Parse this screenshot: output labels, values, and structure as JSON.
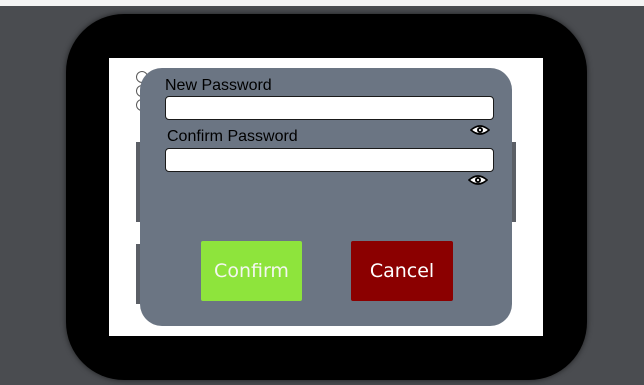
{
  "dialog": {
    "new_password": {
      "label": "New Password",
      "value": "",
      "placeholder": ""
    },
    "confirm_password": {
      "label": "Confirm Password",
      "value": "",
      "placeholder": ""
    },
    "visibility_icon": "eye-icon",
    "confirm_label": "Confirm",
    "cancel_label": "Cancel"
  },
  "colors": {
    "backdrop": "#4a4c50",
    "device_frame": "#000000",
    "screen": "#ffffff",
    "modal": "#6b7583",
    "confirm_button": "#8ee43c",
    "cancel_button": "#8b0000"
  }
}
